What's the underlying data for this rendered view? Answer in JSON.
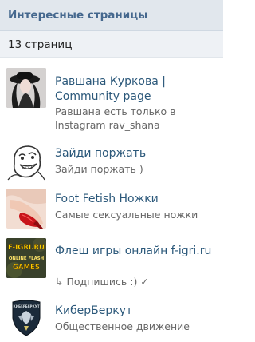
{
  "header": {
    "title": "Интересные страницы"
  },
  "subheader": {
    "count_text": "13 страниц"
  },
  "pages": [
    {
      "title": "Равшана Куркова | Community page",
      "description": "Равшана есть только в Instagram rav_shana",
      "icon": "woman-with-hat-photo"
    },
    {
      "title": "Зайди поржать",
      "description": "Зайди поржать )",
      "icon": "meme-face"
    },
    {
      "title": "Foot Fetish Ножки",
      "description": "Самые сексуальные ножки",
      "icon": "red-shoe-photo"
    },
    {
      "title": "Флеш игры онлайн f-igri.ru",
      "description_prefix": "↳",
      "description": "Подпишись :) ✓",
      "icon": "online-flash-games-logo",
      "logo_text": [
        "F-IGRI.RU",
        "ONLINE FLASH",
        "GAMES"
      ]
    },
    {
      "title": "КиберБеркут",
      "description": "Общественное движение",
      "icon": "shield-emblem",
      "logo_text": "КИБЕРБЕРКУТ"
    }
  ],
  "colors": {
    "header_bg": "#e1e7ed",
    "subheader_bg": "#eef1f5",
    "title_color": "#45688e",
    "link_color": "#2b587a",
    "desc_color": "#666666"
  }
}
